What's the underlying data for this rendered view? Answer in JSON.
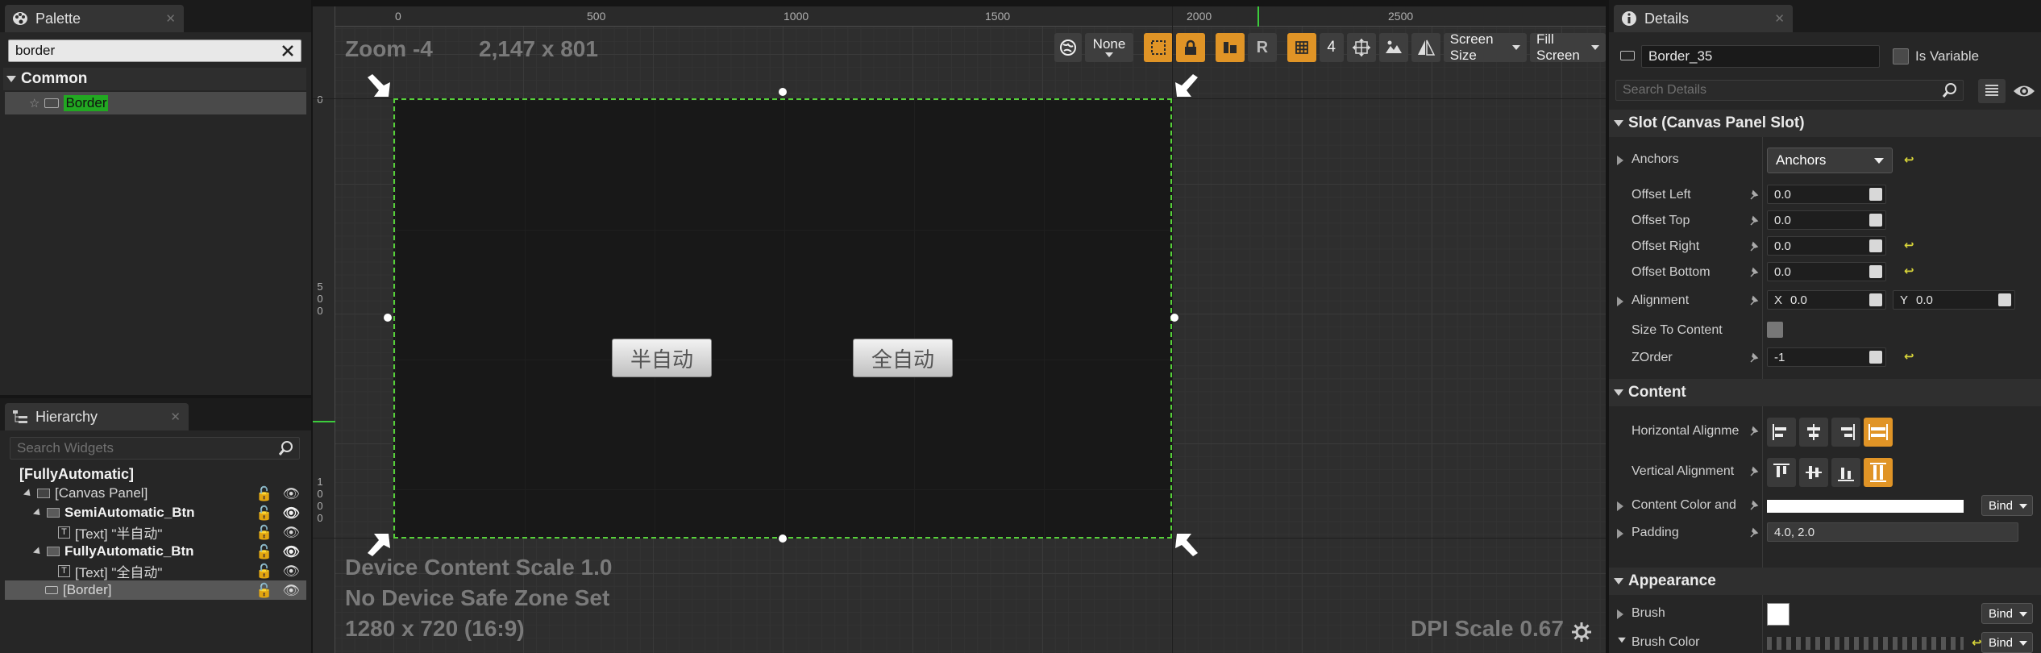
{
  "palette": {
    "tab_title": "Palette",
    "search_value": "border",
    "category": "Common",
    "result_item": "Border"
  },
  "hierarchy": {
    "tab_title": "Hierarchy",
    "search_placeholder": "Search Widgets",
    "items": [
      {
        "label": "[FullyAutomatic]"
      },
      {
        "label": "[Canvas Panel]"
      },
      {
        "label": "SemiAutomatic_Btn"
      },
      {
        "label": "[Text] \"半自动\""
      },
      {
        "label": "FullyAutomatic_Btn"
      },
      {
        "label": "[Text] \"全自动\""
      },
      {
        "label": "[Border]"
      }
    ]
  },
  "viewport": {
    "zoom_label": "Zoom -4",
    "resolution_label": "2,147 x 801",
    "ruler_top": [
      "0",
      "500",
      "1000",
      "1500",
      "2000",
      "2500"
    ],
    "ruler_left": [
      "0",
      "5\n0\n0",
      "1\n0\n0\n0"
    ],
    "device_scale": "Device Content Scale 1.0",
    "safe_zone": "No Device Safe Zone Set",
    "screen_res": "1280 x 720 (16:9)",
    "dpi_scale": "DPI Scale 0.67",
    "toolbar": {
      "localization": "None",
      "retainer": "R",
      "grid_snap": "4",
      "screen_size": "Screen Size",
      "fill_screen": "Fill Screen"
    },
    "buttons": [
      {
        "label": "半自动"
      },
      {
        "label": "全自动"
      }
    ]
  },
  "details": {
    "tab_title": "Details",
    "widget_name": "Border_35",
    "is_variable": "Is Variable",
    "search_placeholder": "Search Details",
    "slot_section": "Slot (Canvas Panel Slot)",
    "anchors_label": "Anchors",
    "anchors_value": "Anchors",
    "offset_left": {
      "label": "Offset Left",
      "value": "0.0"
    },
    "offset_top": {
      "label": "Offset Top",
      "value": "0.0"
    },
    "offset_right": {
      "label": "Offset Right",
      "value": "0.0"
    },
    "offset_bottom": {
      "label": "Offset Bottom",
      "value": "0.0"
    },
    "alignment": {
      "label": "Alignment",
      "x_label": "X",
      "x_value": "0.0",
      "y_label": "Y",
      "y_value": "0.0"
    },
    "size_to_content": "Size To Content",
    "zorder": {
      "label": "ZOrder",
      "value": "-1"
    },
    "content_section": "Content",
    "horizontal_alignment": "Horizontal Alignme",
    "vertical_alignment": "Vertical Alignment",
    "content_color": "Content Color and",
    "padding": {
      "label": "Padding",
      "value": "4.0, 2.0"
    },
    "appearance_section": "Appearance",
    "brush": "Brush",
    "brush_color": "Brush Color",
    "bind_label": "Bind"
  }
}
